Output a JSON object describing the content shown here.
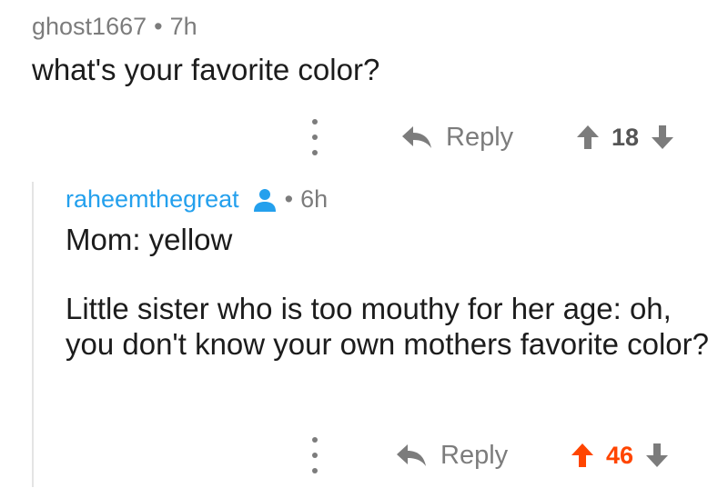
{
  "parent_comment": {
    "author": "ghost1667",
    "separator": "•",
    "time": "7h",
    "text": "what's your favorite color?",
    "reply_label": "Reply",
    "score": "18"
  },
  "child_comment": {
    "author": "raheemthegreat",
    "separator": "•",
    "time": "6h",
    "paragraphs": [
      "Mom: yellow",
      "Little sister who is too mouthy for her age: oh, you don't know your own mothers favorite color?"
    ],
    "reply_label": "Reply",
    "score": "46",
    "vote_state": "upvoted"
  },
  "colors": {
    "author_link": "#24a0ed",
    "upvote": "#ff4500",
    "muted": "#7c7c7c"
  },
  "icons": [
    "more-options-icon",
    "reply-arrow-icon",
    "upvote-arrow-icon",
    "downvote-arrow-icon",
    "user-icon"
  ]
}
